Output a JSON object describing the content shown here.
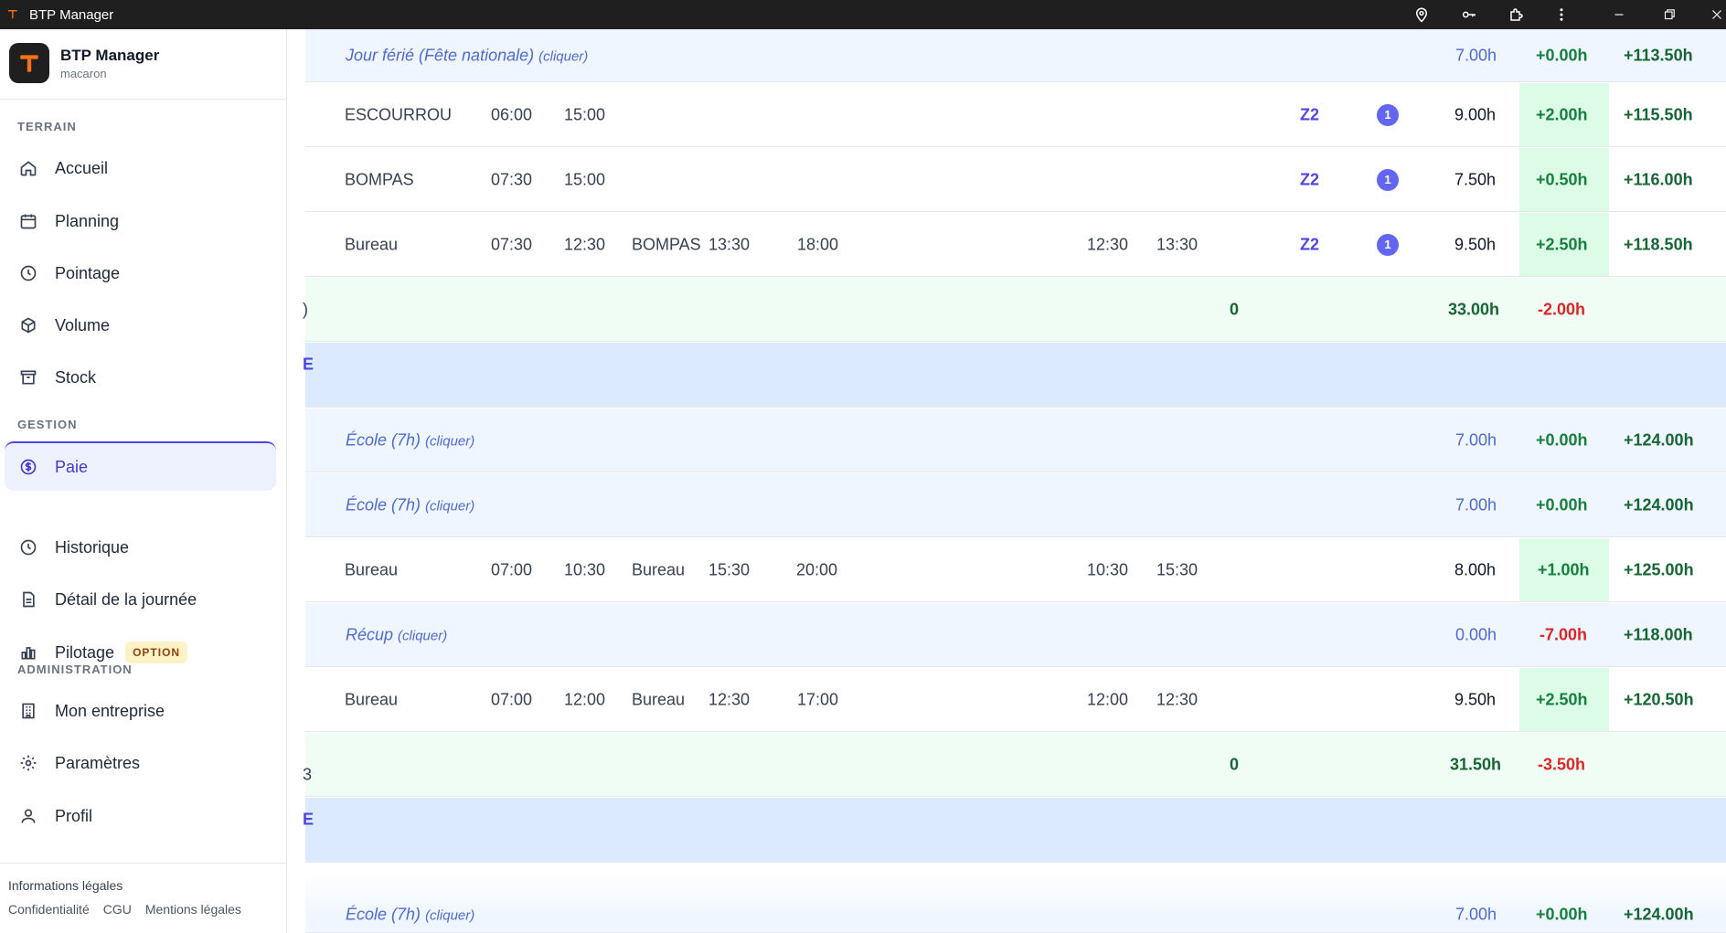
{
  "titlebar": {
    "title": "BTP Manager",
    "icons": [
      "map-pin-icon",
      "key-icon",
      "extension-icon",
      "more-vertical-icon",
      "minimize-icon",
      "restore-icon",
      "close-icon"
    ]
  },
  "brand": {
    "name": "BTP Manager",
    "subtitle": "macaron"
  },
  "sidebar": {
    "sections": [
      {
        "label": "TERRAIN",
        "items": [
          {
            "label": "Accueil",
            "icon": "home-icon"
          },
          {
            "label": "Planning",
            "icon": "calendar-icon"
          },
          {
            "label": "Pointage",
            "icon": "clock-icon"
          },
          {
            "label": "Volume",
            "icon": "box-icon"
          },
          {
            "label": "Stock",
            "icon": "archive-icon"
          }
        ]
      },
      {
        "label": "GESTION",
        "items": [
          {
            "label": "Paie",
            "icon": "dollar-circle-icon",
            "active": true
          },
          {
            "label": "Historique",
            "icon": "history-icon"
          },
          {
            "label": "Détail de la journée",
            "icon": "file-icon"
          },
          {
            "label": "Pilotage",
            "icon": "bar-chart-icon",
            "badge": "OPTION"
          }
        ]
      },
      {
        "label": "ADMINISTRATION",
        "items": [
          {
            "label": "Mon entreprise",
            "icon": "building-icon"
          },
          {
            "label": "Paramètres",
            "icon": "settings-icon"
          },
          {
            "label": "Profil",
            "icon": "user-icon"
          }
        ]
      }
    ],
    "legal": {
      "title": "Informations légales",
      "links": [
        "Confidentialité",
        "CGU",
        "Mentions légales"
      ]
    }
  },
  "table": {
    "rows": [
      {
        "type": "holiday",
        "label": "Jour férié (Fête nationale)",
        "hint": "(cliquer)",
        "hours": "7.00h",
        "delta": "+0.00h",
        "cumul": "+113.50h"
      },
      {
        "type": "work",
        "site1": "ESCOURROU",
        "start1": "06:00",
        "end1": "15:00",
        "site2": "",
        "start2": "",
        "end2": "",
        "pause_start": "",
        "pause_end": "",
        "zone": "Z2",
        "count": "1",
        "hours": "9.00h",
        "delta": "+2.00h",
        "cumul": "+115.50h"
      },
      {
        "type": "work",
        "site1": "BOMPAS",
        "start1": "07:30",
        "end1": "15:00",
        "site2": "",
        "start2": "",
        "end2": "",
        "pause_start": "",
        "pause_end": "",
        "zone": "Z2",
        "count": "1",
        "hours": "7.50h",
        "delta": "+0.50h",
        "cumul": "+116.00h"
      },
      {
        "type": "work",
        "site1": "Bureau",
        "start1": "07:30",
        "end1": "12:30",
        "site2": "BOMPAS",
        "start2": "13:30",
        "end2": "18:00",
        "pause_start": "12:30",
        "pause_end": "13:30",
        "zone": "Z2",
        "count": "1",
        "hours": "9.50h",
        "delta": "+2.50h",
        "cumul": "+118.50h"
      },
      {
        "type": "total",
        "edge": ")",
        "count": "0",
        "hours": "33.00h",
        "delta": "-2.00h"
      },
      {
        "type": "section",
        "edge": "E"
      },
      {
        "type": "holiday",
        "label": "École (7h)",
        "hint": "(cliquer)",
        "hours": "7.00h",
        "delta": "+0.00h",
        "cumul": "+124.00h"
      },
      {
        "type": "holiday",
        "label": "École (7h)",
        "hint": "(cliquer)",
        "hours": "7.00h",
        "delta": "+0.00h",
        "cumul": "+124.00h"
      },
      {
        "type": "work",
        "site1": "Bureau",
        "start1": "07:00",
        "end1": "10:30",
        "site2": "Bureau",
        "start2": "15:30",
        "end2": "20:00",
        "pause_start": "10:30",
        "pause_end": "15:30",
        "zone": "",
        "count": "",
        "hours": "8.00h",
        "delta": "+1.00h",
        "cumul": "+125.00h"
      },
      {
        "type": "holiday",
        "label": "Récup",
        "hint": "(cliquer)",
        "hours": "0.00h",
        "delta": "-7.00h",
        "cumul": "+118.00h"
      },
      {
        "type": "work",
        "site1": "Bureau",
        "start1": "07:00",
        "end1": "12:00",
        "site2": "Bureau",
        "start2": "12:30",
        "end2": "17:00",
        "pause_start": "12:00",
        "pause_end": "12:30",
        "zone": "",
        "count": "",
        "hours": "9.50h",
        "delta": "+2.50h",
        "cumul": "+120.50h"
      },
      {
        "type": "total",
        "edge": "3",
        "count": "0",
        "hours": "31.50h",
        "delta": "-3.50h"
      },
      {
        "type": "section",
        "edge": "E"
      },
      {
        "type": "holiday",
        "label": "École (7h)",
        "hint": "(cliquer)",
        "hours": "7.00h",
        "delta": "+0.00h",
        "cumul": "+124.00h"
      }
    ]
  },
  "colors": {
    "accent": "#4f46e5",
    "positive": "#15803d",
    "negative": "#dc2626",
    "holiday": "#4f6ad0"
  }
}
